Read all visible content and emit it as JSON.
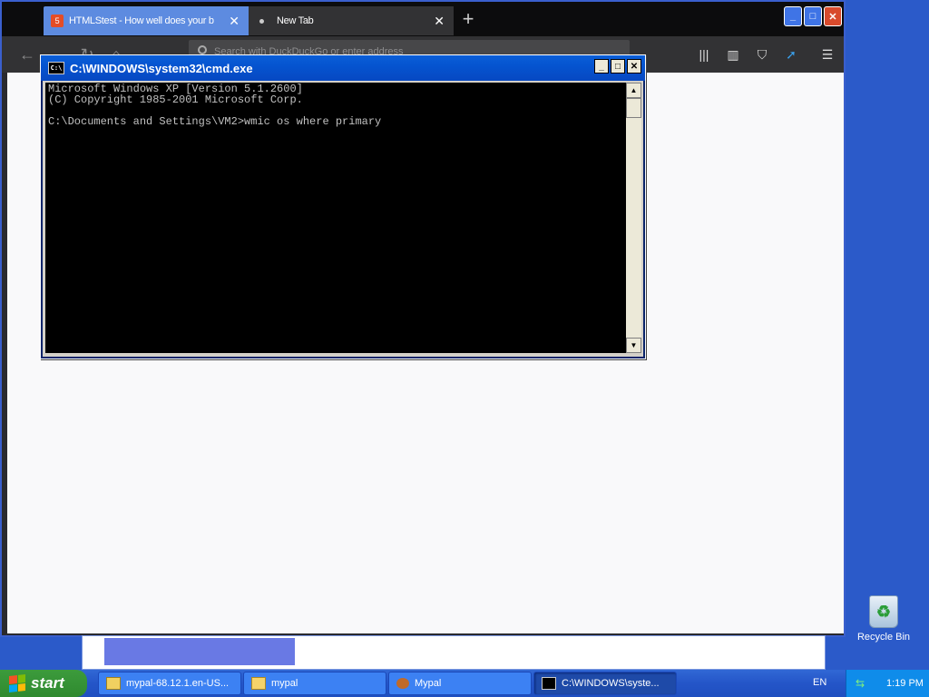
{
  "browser": {
    "tabs": [
      {
        "title": "HTMLStest - How well does your b",
        "favicon": "html5-icon",
        "active": false
      },
      {
        "title": "New Tab",
        "active": true
      }
    ],
    "new_tab_label": "+",
    "url_placeholder": "Search with DuckDuckGo or enter address",
    "accent": "#5d8be0"
  },
  "cmd": {
    "title": "C:\\WINDOWS\\system32\\cmd.exe",
    "icon_label": "C:\\",
    "lines": "Microsoft Windows XP [Version 5.1.2600]\n(C) Copyright 1985-2001 Microsoft Corp.\n\nC:\\Documents and Settings\\VM2>wmic os where primary"
  },
  "desktop": {
    "recycle_bin_label": "Recycle Bin"
  },
  "taskbar": {
    "start_label": "start",
    "tasks": [
      {
        "label": "mypal-68.12.1.en-US...",
        "icon": "installer-icon"
      },
      {
        "label": "mypal",
        "icon": "folder-icon"
      },
      {
        "label": "Mypal",
        "icon": "mypal-icon"
      },
      {
        "label": "C:\\WINDOWS\\syste...",
        "icon": "cmd-icon",
        "active": true
      }
    ],
    "language": "EN",
    "clock": "1:19 PM"
  }
}
